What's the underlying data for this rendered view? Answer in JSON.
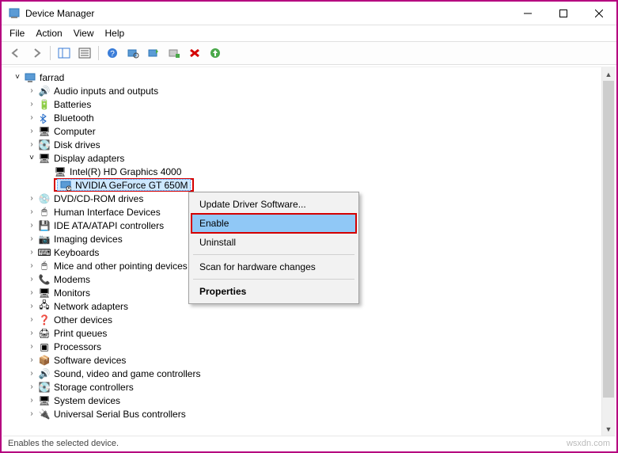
{
  "window": {
    "title": "Device Manager"
  },
  "menu": {
    "file": "File",
    "action": "Action",
    "view": "View",
    "help": "Help"
  },
  "tree": {
    "root": "farrad",
    "items": [
      "Audio inputs and outputs",
      "Batteries",
      "Bluetooth",
      "Computer",
      "Disk drives",
      "Display adapters",
      "DVD/CD-ROM drives",
      "Human Interface Devices",
      "IDE ATA/ATAPI controllers",
      "Imaging devices",
      "Keyboards",
      "Mice and other pointing devices",
      "Modems",
      "Monitors",
      "Network adapters",
      "Other devices",
      "Print queues",
      "Processors",
      "Software devices",
      "Sound, video and game controllers",
      "Storage controllers",
      "System devices",
      "Universal Serial Bus controllers"
    ],
    "display_children": [
      "Intel(R) HD Graphics 4000",
      "NVIDIA GeForce GT 650M"
    ]
  },
  "context_menu": {
    "update": "Update Driver Software...",
    "enable": "Enable",
    "uninstall": "Uninstall",
    "scan": "Scan for hardware changes",
    "properties": "Properties"
  },
  "status": {
    "text": "Enables the selected device.",
    "watermark": "wsxdn.com"
  }
}
